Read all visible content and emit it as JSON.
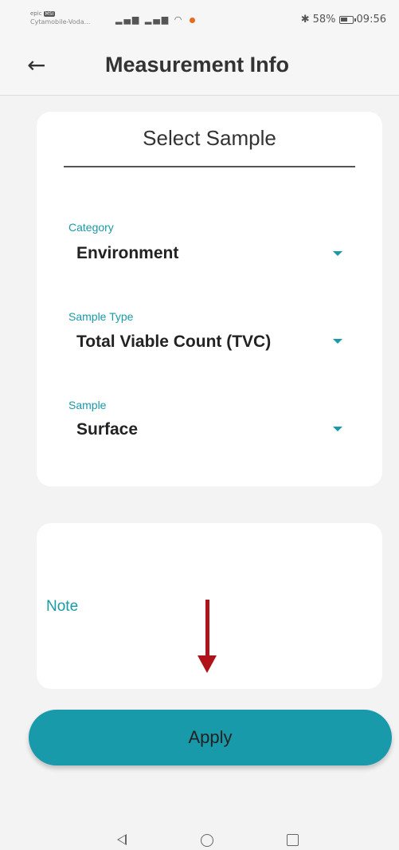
{
  "status_bar": {
    "carrier_top": "epic",
    "carrier_badge": "MSI",
    "carrier_bottom": "Cytamobile-Voda...",
    "battery_percent": "58%",
    "time": "09:56",
    "icons": [
      "signal-icon",
      "signal-icon",
      "wifi-icon",
      "notification-dot-icon",
      "bluetooth-icon",
      "battery-icon"
    ]
  },
  "app_bar": {
    "back_icon": "arrow-left-icon",
    "title": "Measurement Info"
  },
  "select_sample": {
    "title": "Select Sample",
    "fields": [
      {
        "label": "Category",
        "value": "Environment"
      },
      {
        "label": "Sample Type",
        "value": "Total Viable Count (TVC)"
      },
      {
        "label": "Sample",
        "value": "Surface"
      }
    ]
  },
  "note": {
    "label": "Note"
  },
  "apply_button": {
    "label": "Apply"
  },
  "colors": {
    "accent": "#1a9aa8",
    "button": "#199aab",
    "annotation_arrow": "#b0121a"
  },
  "nav_bar": {
    "icons": [
      "nav-back-icon",
      "nav-home-icon",
      "nav-recent-icon"
    ]
  }
}
